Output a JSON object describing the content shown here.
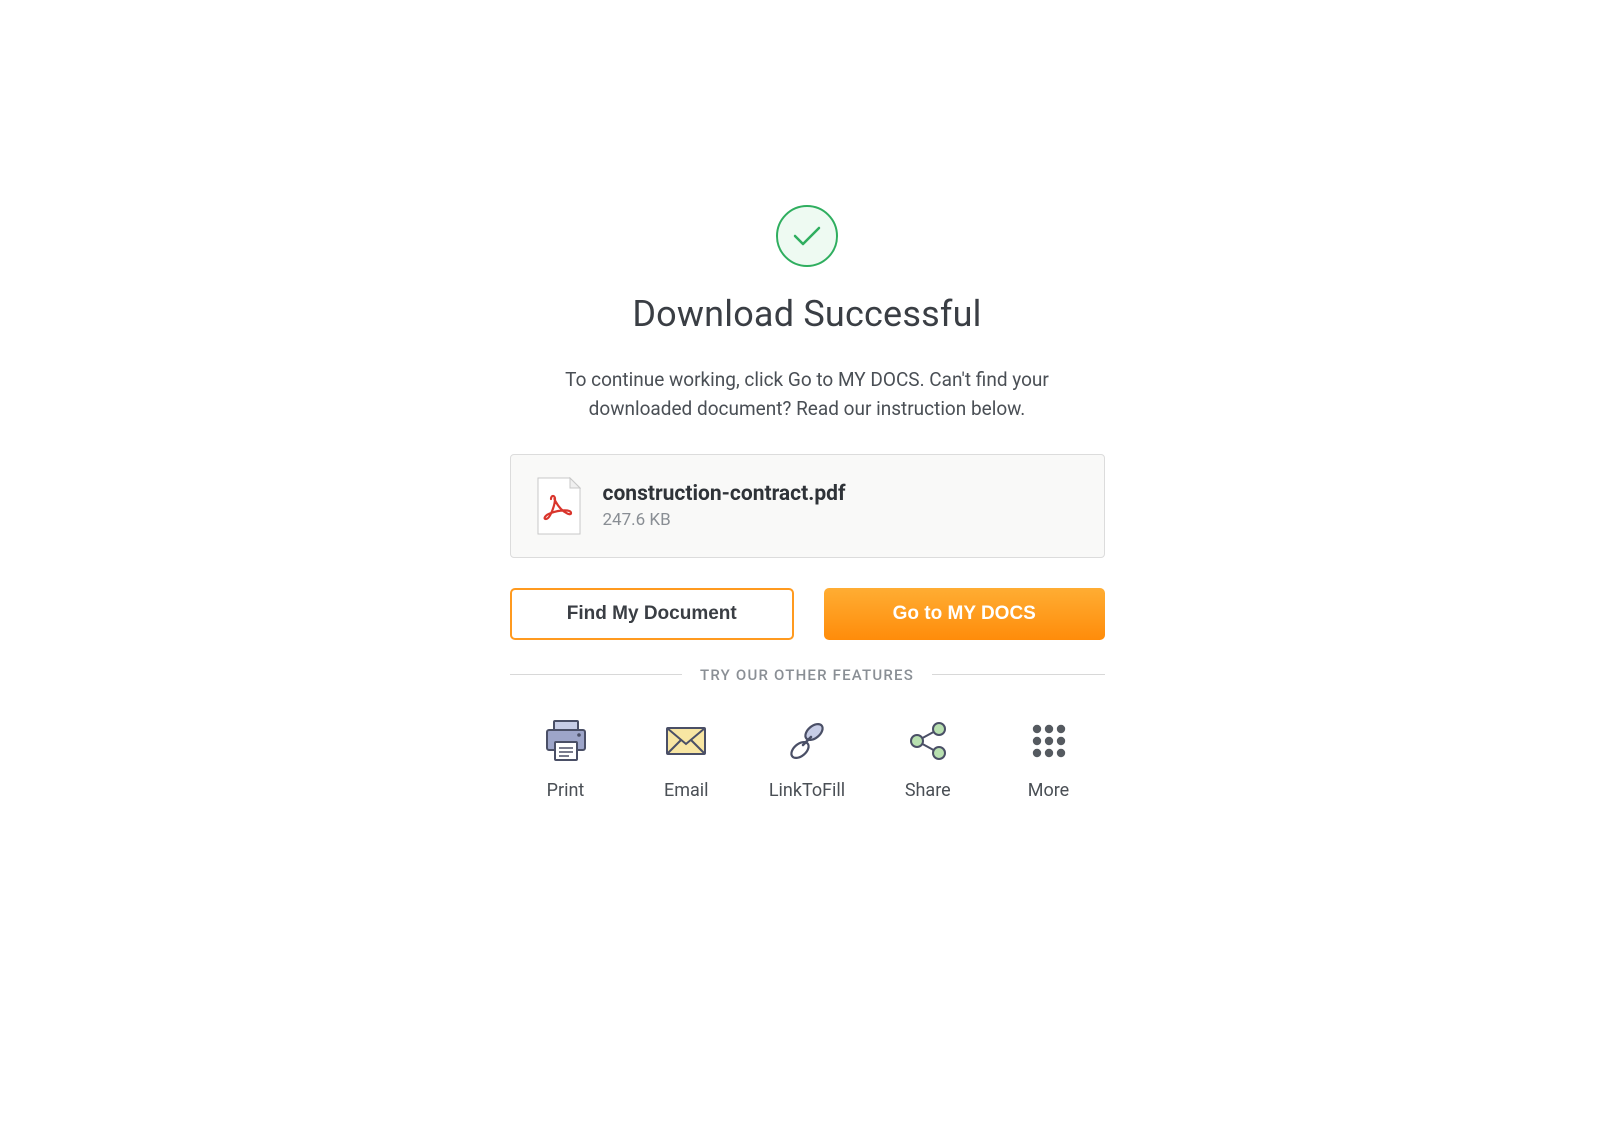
{
  "header": {
    "title": "Download Successful",
    "subtitle": "To continue working, click Go to MY DOCS. Can't find your downloaded document? Read our instruction below."
  },
  "file": {
    "name": "construction-contract.pdf",
    "size": "247.6 KB"
  },
  "buttons": {
    "find": "Find My Document",
    "goto": "Go to MY DOCS"
  },
  "divider": {
    "text": "TRY OUR OTHER FEATURES"
  },
  "features": {
    "print": "Print",
    "email": "Email",
    "linktofill": "LinkToFill",
    "share": "Share",
    "more": "More"
  }
}
